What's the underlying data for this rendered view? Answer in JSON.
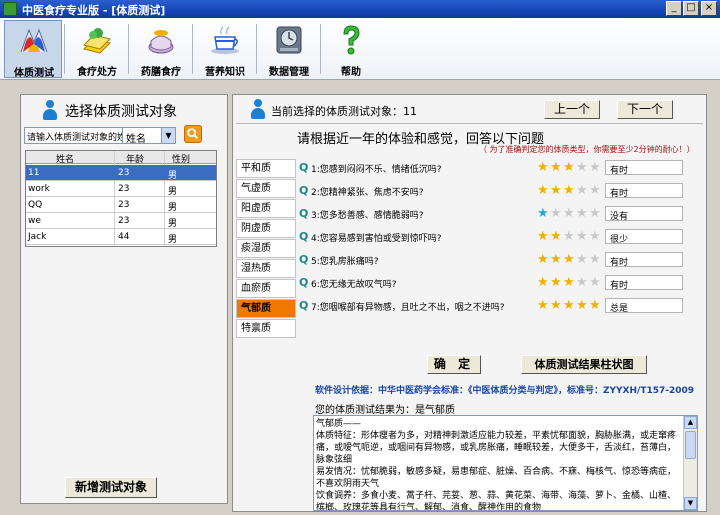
{
  "window": {
    "title": "中医食疗专业版 - [体质测试]",
    "min": "_",
    "max": "□",
    "close": "×"
  },
  "toolbar": {
    "items": [
      {
        "label": "体质测试",
        "icon": "constitution-test-icon"
      },
      {
        "label": "食疗处方",
        "icon": "prescription-book-icon"
      },
      {
        "label": "药膳食疗",
        "icon": "herbal-pot-icon"
      },
      {
        "label": "营养知识",
        "icon": "coffee-cup-icon"
      },
      {
        "label": "数据管理",
        "icon": "data-clock-icon"
      },
      {
        "label": "帮助",
        "icon": "help-question-icon"
      }
    ]
  },
  "left": {
    "title": "选择体质测试对象",
    "search_placeholder": "请输入体质测试对象的姓",
    "search_field": "姓名",
    "select_arrow": "▼",
    "columns": [
      "姓名",
      "年龄",
      "性别"
    ],
    "rows": [
      [
        "11",
        "23",
        "男"
      ],
      [
        "work",
        "23",
        "男"
      ],
      [
        "QQ",
        "23",
        "男"
      ],
      [
        "we",
        "23",
        "男"
      ],
      [
        "Jack",
        "44",
        "男"
      ]
    ],
    "add_button": "新增测试对象"
  },
  "right": {
    "current_label": "当前选择的体质测试对象：11",
    "prev_button": "上一个",
    "next_button": "下一个",
    "question_heading": "请根据近一年的体验和感觉，回答以下问题",
    "question_note": "（ 为了准确判定您的体质类型，你需要至少2分钟的耐心！）",
    "types": [
      "平和质",
      "气虚质",
      "阳虚质",
      "阴虚质",
      "痰湿质",
      "湿热质",
      "血瘀质",
      "气郁质",
      "特禀质"
    ],
    "active_type_index": 7,
    "q_marker": "Q",
    "star_glyph": "★",
    "questions": [
      {
        "text": "1:您感到闷闷不乐、情绪低沉吗?",
        "rating": 3,
        "answer": "有时"
      },
      {
        "text": "2:您精神紧张、焦虑不安吗?",
        "rating": 3,
        "answer": "有时"
      },
      {
        "text": "3:您多愁善感、感情脆弱吗?",
        "rating": 1,
        "answer": "没有"
      },
      {
        "text": "4:您容易感到害怕或受到惊吓吗?",
        "rating": 2,
        "answer": "很少"
      },
      {
        "text": "5:您乳房胀痛吗?",
        "rating": 3,
        "answer": "有时"
      },
      {
        "text": "6:您无缘无故叹气吗?",
        "rating": 3,
        "answer": "有时"
      },
      {
        "text": "7:您咽喉部有异物感，且吐之不出，咽之不进吗?",
        "rating": 5,
        "answer": "总是"
      }
    ],
    "confirm_button": "确 定",
    "chart_button": "体质测试结果柱状图",
    "basis": "软件设计依据：中华中医药学会标准：《中医体质分类与判定》，标准号：ZYYXH/T157-2009",
    "result_label": "您的体质测试结果为：是气郁质",
    "result_lines": [
      "气郁质——",
      "体质特征：形体瘦者为多，对精神刺激适应能力较差，平素忧郁面貌，胸胁胀满，或走窜疼痛，或嗳气呃逆，或咽间有异物感，或乳房胀痛，睡眠较差，大便多干，舌淡红，苔薄白，脉象弦细",
      "易发情况：忧郁脆弱，敏感多疑，易患郁症、脏燥、百合病、不寐、梅核气、惊恐等病症，不喜欢阴雨天气",
      "饮食调养：多食小麦、蒿子杆、芫荽、葱、蒜、黄花菜、海带、海藻、萝卜、金橘、山楂、槟榔、玫瑰花等具有行气、解郁、消食、醒神作用的食物"
    ],
    "scroll_up": "▲",
    "scroll_down": "▼"
  },
  "colors": {
    "title_bar": "#1746b4",
    "selected_row": "#3b6cc2",
    "active_tab": "#f07800",
    "star_on": "#f0b000",
    "q_marker": "#1a8a8a",
    "basis_text": "#1a45a8"
  }
}
